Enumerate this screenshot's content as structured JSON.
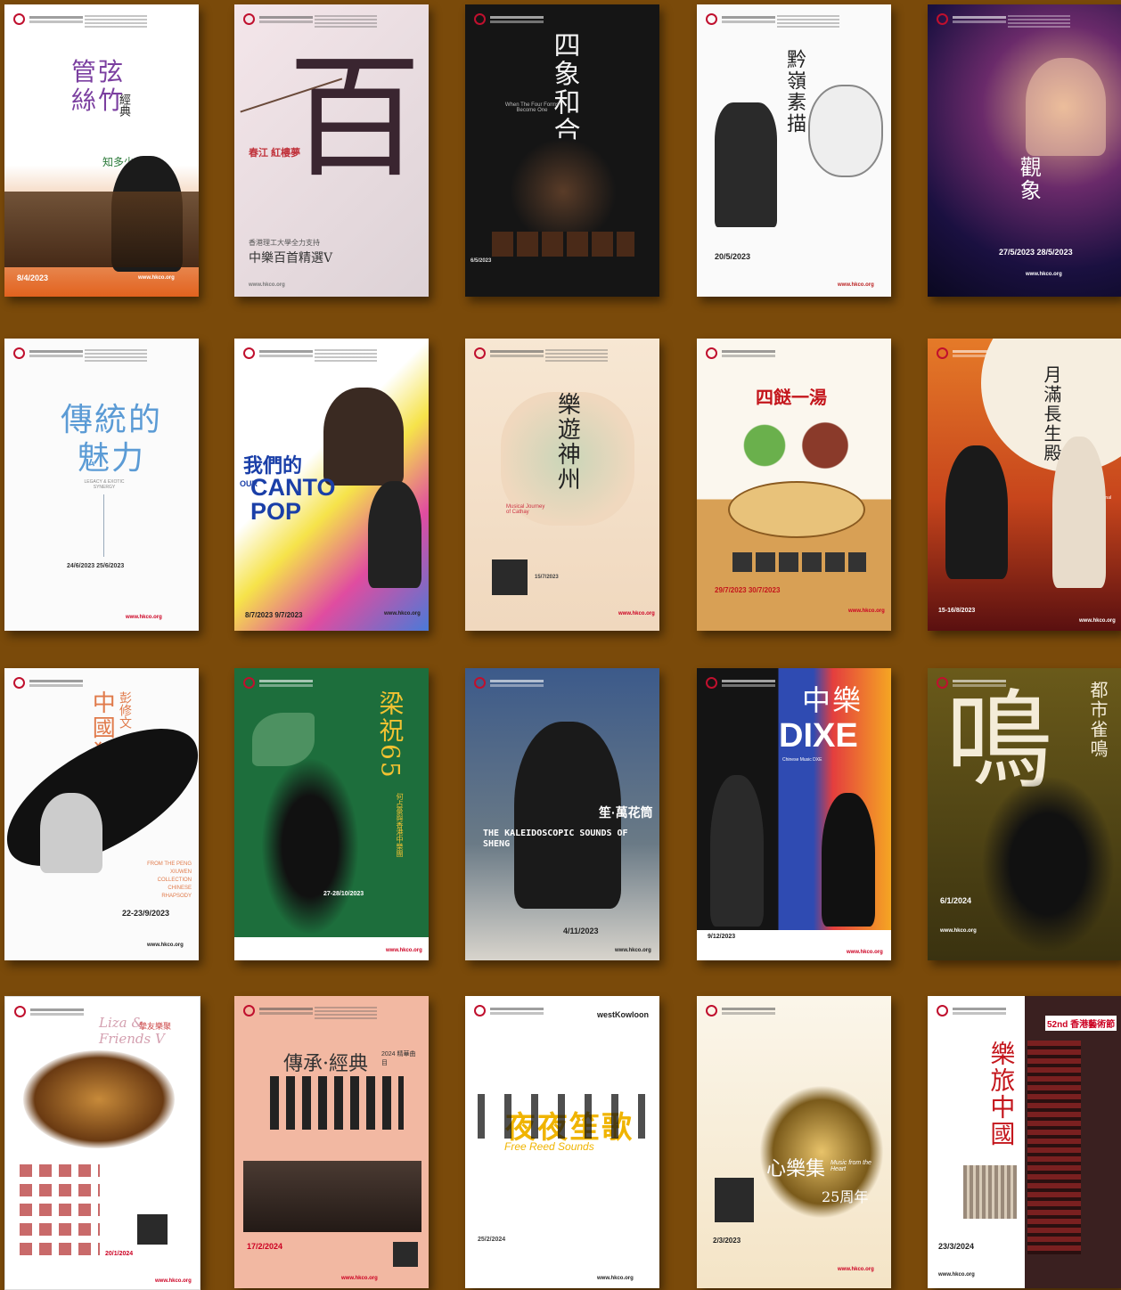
{
  "background": "#7a4a0a",
  "posters": [
    {
      "title": "管弦絲竹",
      "subtitle": "經典",
      "extra": "知多少",
      "date": "8/4/2023",
      "url": "www.hkco.org"
    },
    {
      "title": "百",
      "subtitle": "香港理工大學全力支持",
      "extra": "中樂百首精選V",
      "date": "春江 紅樓夢",
      "url": "www.hkco.org"
    },
    {
      "title": "四象和合",
      "subtitle": "When The Four Forms Become One",
      "extra": "",
      "date": "6/5/2023",
      "url": ""
    },
    {
      "title": "黔嶺素描",
      "subtitle": "",
      "extra": "",
      "date": "20/5/2023",
      "url": "www.hkco.org"
    },
    {
      "title": "觀象",
      "subtitle": "",
      "extra": "",
      "date": "27/5/2023  28/5/2023",
      "url": "www.hkco.org"
    },
    {
      "title": "傳統的魅力",
      "subtitle": "LEGACY & EXOTIC SYNERGY",
      "extra": "",
      "date": "24/6/2023  25/6/2023",
      "url": "www.hkco.org"
    },
    {
      "title": "我們的",
      "subtitle": "CANTO POP",
      "extra": "OUR",
      "date": "8/7/2023  9/7/2023",
      "url": "www.hkco.org"
    },
    {
      "title": "樂遊神州",
      "subtitle": "Musical Journey of Cathay",
      "extra": "",
      "date": "15/7/2023",
      "url": "www.hkco.org"
    },
    {
      "title": "四餸一湯",
      "subtitle": "",
      "extra": "",
      "date": "29/7/2023  30/7/2023",
      "url": "www.hkco.org"
    },
    {
      "title": "月滿長生殿",
      "subtitle": "The Palace of Eternal Life",
      "extra": "",
      "date": "15-16/8/2023",
      "url": "www.hkco.org"
    },
    {
      "title": "中國狂想曲",
      "subtitle": "彭修文",
      "extra": "FROM THE PENG XIUWEN COLLECTION CHINESE RHAPSODY",
      "date": "22-23/9/2023",
      "url": "www.hkco.org"
    },
    {
      "title": "梁祝65",
      "subtitle": "何占豪與香港中樂團",
      "extra": "",
      "date": "27-28/10/2023",
      "url": "www.hkco.org"
    },
    {
      "title": "笙·萬花筒",
      "subtitle": "THE KALEIDOSCOPIC SOUNDS OF SHENG",
      "extra": "",
      "date": "4/11/2023",
      "url": "www.hkco.org"
    },
    {
      "title": "中樂",
      "subtitle": "DIXE",
      "extra": "Chinese Music DXE",
      "date": "9/12/2023",
      "url": "www.hkco.org"
    },
    {
      "title": "都市雀鳴",
      "subtitle": "鳴",
      "extra": "",
      "date": "6/1/2024",
      "url": "www.hkco.org"
    },
    {
      "title": "Liza & Friends V",
      "subtitle": "摯友樂聚",
      "extra": "",
      "date": "20/1/2024",
      "url": "www.hkco.org"
    },
    {
      "title": "傳承·經典",
      "subtitle": "2024 精華曲目",
      "extra": "",
      "date": "17/2/2024",
      "url": "www.hkco.org"
    },
    {
      "title": "夜夜笙歌",
      "subtitle": "Free Reed Sounds",
      "extra": "westKowloon",
      "date": "25/2/2024",
      "url": "www.hkco.org"
    },
    {
      "title": "心樂集",
      "subtitle": "Music from the Heart",
      "extra": "25周年",
      "date": "2/3/2023",
      "url": "www.hkco.org"
    },
    {
      "title": "樂旅中國",
      "subtitle": "52nd 香港藝術節",
      "extra": "",
      "date": "23/3/2024",
      "url": "www.hkco.org"
    }
  ]
}
